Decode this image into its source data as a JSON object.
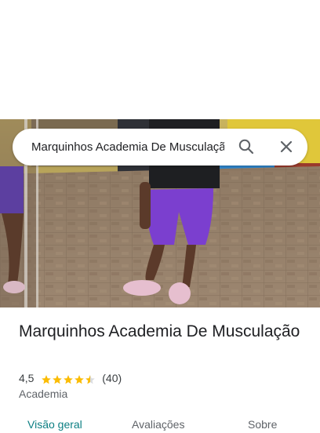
{
  "search": {
    "query": "Marquinhos Academia De Musculação",
    "search_icon": "search-icon",
    "close_icon": "close-icon"
  },
  "place": {
    "name": "Marquinhos Academia De Musculação",
    "rating": "4,5",
    "rating_value": 4.5,
    "rating_max": 5,
    "review_count": "(40)",
    "category": "Academia"
  },
  "tabs": [
    {
      "label": "Visão geral",
      "active": true
    },
    {
      "label": "Avaliações",
      "active": false
    },
    {
      "label": "Sobre",
      "active": false
    }
  ],
  "colors": {
    "star": "#FBBC04",
    "active_tab": "#0B7E82",
    "star_empty": "#DADCE0"
  }
}
